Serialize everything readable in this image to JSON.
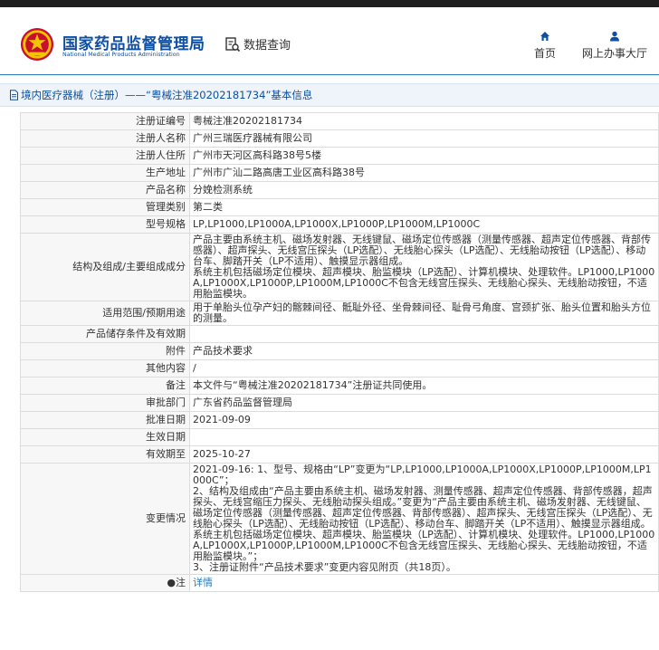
{
  "header": {
    "logo_cn": "国家药品监督管理局",
    "logo_en": "National Medical Products Administration",
    "search_label": "数据查询",
    "nav": [
      {
        "label": "首页",
        "icon": "home-icon"
      },
      {
        "label": "网上办事大厅",
        "icon": "user-icon"
      }
    ]
  },
  "breadcrumb": "境内医疗器械（注册）——“粤械注准20202181734”基本信息",
  "rows": [
    {
      "key": "注册证编号",
      "value": "粤械注准20202181734"
    },
    {
      "key": "注册人名称",
      "value": "广州三瑞医疗器械有限公司"
    },
    {
      "key": "注册人住所",
      "value": "广州市天河区高科路38号5楼"
    },
    {
      "key": "生产地址",
      "value": "广州市广汕二路高唐工业区高科路38号"
    },
    {
      "key": "产品名称",
      "value": "分娩检测系统"
    },
    {
      "key": "管理类别",
      "value": "第二类"
    },
    {
      "key": "型号规格",
      "value": "LP,LP1000,LP1000A,LP1000X,LP1000P,LP1000M,LP1000C"
    },
    {
      "key": "结构及组成/主要组成成分",
      "value": "产品主要由系统主机、磁场发射器、无线键鼠、磁场定位传感器（测量传感器、超声定位传感器、背部传感器）、超声探头、无线宫压探头（LP选配）、无线胎心探头（LP选配）、无线胎动按钮（LP选配）、移动台车、脚踏开关（LP不适用）、触摸显示器组成。\n系统主机包括磁场定位模块、超声模块、胎监模块（LP选配）、计算机模块、处理软件。LP1000,LP1000A,LP1000X,LP1000P,LP1000M,LP1000C不包含无线宫压探头、无线胎心探头、无线胎动按钮，不适用胎监模块。"
    },
    {
      "key": "适用范围/预期用途",
      "value": "用于单胎头位孕产妇的髂棘间径、骶耻外径、坐骨棘间径、耻骨弓角度、宫颈扩张、胎头位置和胎头方位的测量。"
    },
    {
      "key": "产品储存条件及有效期",
      "value": ""
    },
    {
      "key": "附件",
      "value": "产品技术要求"
    },
    {
      "key": "其他内容",
      "value": "/"
    },
    {
      "key": "备注",
      "value": "本文件与“粤械注准20202181734”注册证共同使用。"
    },
    {
      "key": "审批部门",
      "value": "广东省药品监督管理局"
    },
    {
      "key": "批准日期",
      "value": "2021-09-09"
    },
    {
      "key": "生效日期",
      "value": ""
    },
    {
      "key": "有效期至",
      "value": "2025-10-27"
    },
    {
      "key": "变更情况",
      "value": "2021-09-16: 1、型号、规格由“LP”变更为“LP,LP1000,LP1000A,LP1000X,LP1000P,LP1000M,LP1000C”；\n2、结构及组成由“产品主要由系统主机、磁场发射器、测量传感器、超声定位传感器、背部传感器，超声探头、无线宫缩压力探头、无线胎动探头组成。”变更为“产品主要由系统主机、磁场发射器、无线键鼠、磁场定位传感器（测量传感器、超声定位传感器、背部传感器）、超声探头、无线宫压探头（LP选配）、无线胎心探头（LP选配）、无线胎动按钮（LP选配）、移动台车、脚踏开关（LP不适用）、触摸显示器组成。\n系统主机包括磁场定位模块、超声模块、胎监模块（LP选配）、计算机模块、处理软件。LP1000,LP1000A,LP1000X,LP1000P,LP1000M,LP1000C不包含无线宫压探头、无线胎心探头、无线胎动按钮，不适用胎监模块。”；\n3、注册证附件“产品技术要求”变更内容见附页（共18页）。"
    },
    {
      "key": "●注",
      "value": "详情"
    }
  ]
}
